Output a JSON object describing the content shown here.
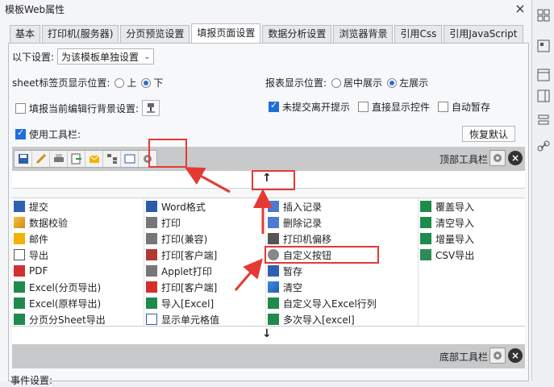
{
  "window": {
    "title": "模板Web属性"
  },
  "tabs": [
    {
      "label": "基本"
    },
    {
      "label": "打印机(服务器)"
    },
    {
      "label": "分页预览设置"
    },
    {
      "label": "填报页面设置"
    },
    {
      "label": "数据分析设置"
    },
    {
      "label": "浏览器背景"
    },
    {
      "label": "引用Css"
    },
    {
      "label": "引用JavaScript"
    }
  ],
  "settings": {
    "label": "以下设置:",
    "select_value": "为该模板单独设置"
  },
  "sheet_tab": {
    "label": "sheet标签页显示位置:",
    "options": [
      {
        "label": "上",
        "checked": false
      },
      {
        "label": "下",
        "checked": true
      }
    ]
  },
  "report_pos": {
    "label": "报表显示位置:",
    "options": [
      {
        "label": "居中展示",
        "checked": false
      },
      {
        "label": "左展示",
        "checked": true
      }
    ]
  },
  "checks": {
    "fill_bg": {
      "label": "填报当前编辑行背景设置:",
      "checked": false
    },
    "unsubmitted": {
      "label": "未提交离开提示",
      "checked": true
    },
    "direct_show": {
      "label": "直接显示控件",
      "checked": false
    },
    "autosave": {
      "label": "自动暂存",
      "checked": false
    },
    "use_toolbar": {
      "label": "使用工具栏:",
      "checked": true
    }
  },
  "restore_button": "恢复默认",
  "top_toolbar_label": "顶部工具栏",
  "bottom_toolbar_label": "底部工具栏",
  "below_text": "事件设置:",
  "grid": {
    "col1": [
      "提交",
      "数据校验",
      "邮件",
      "导出",
      "PDF",
      "Excel(分页导出)",
      "Excel(原样导出)",
      "分页分Sheet导出"
    ],
    "col2": [
      "Word格式",
      "打印",
      "打印(兼容)",
      "打印[客户端]",
      "Applet打印",
      "打印[客户端]",
      "导入[Excel]",
      "显示单元格值"
    ],
    "col3": [
      "插入记录",
      "删除记录",
      "打印机偏移",
      "自定义按钮",
      "暂存",
      "清空",
      "自定义导入Excel行列",
      "多次导入[excel]"
    ],
    "col4": [
      "覆盖导入",
      "清空导入",
      "增量导入",
      "CSV导出"
    ]
  },
  "colors": {
    "accent": "#1e6fd9",
    "annotation": "#e53935"
  }
}
